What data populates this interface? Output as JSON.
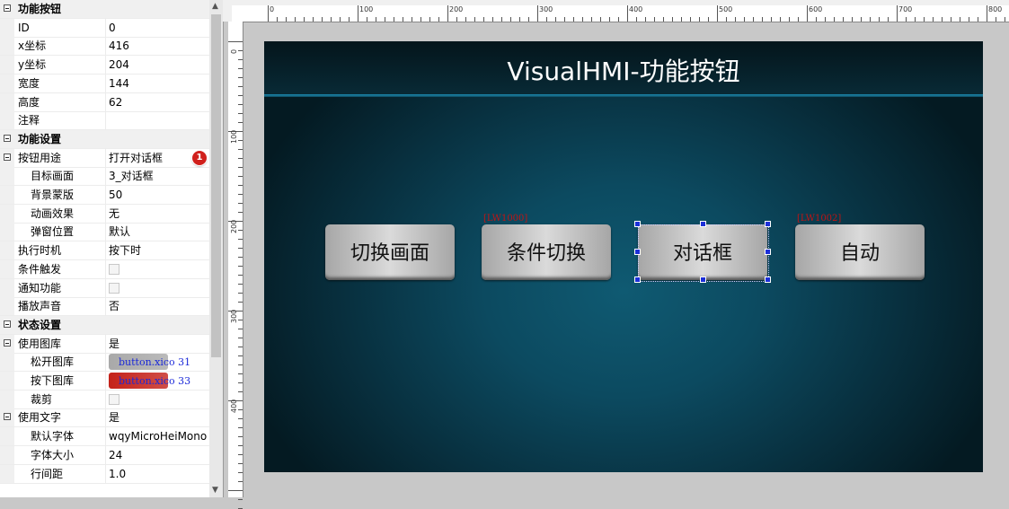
{
  "properties": [
    {
      "type": "category",
      "name": "功能按钮",
      "collapse_icon": "minus-box"
    },
    {
      "type": "prop",
      "name": "ID",
      "value": "0"
    },
    {
      "type": "prop",
      "name": "x坐标",
      "value": "416"
    },
    {
      "type": "prop",
      "name": "y坐标",
      "value": "204"
    },
    {
      "type": "prop",
      "name": "宽度",
      "value": "144"
    },
    {
      "type": "prop",
      "name": "高度",
      "value": "62"
    },
    {
      "type": "prop",
      "name": "注释",
      "value": ""
    },
    {
      "type": "category",
      "name": "功能设置",
      "collapse_icon": "minus-box"
    },
    {
      "type": "group",
      "name": "按钮用途",
      "value": "打开对话框",
      "badge": "1",
      "collapse_icon": "minus-box"
    },
    {
      "type": "sub",
      "name": "目标画面",
      "value": "3_对话框"
    },
    {
      "type": "sub",
      "name": "背景蒙版",
      "value": "50"
    },
    {
      "type": "sub",
      "name": "动画效果",
      "value": "无"
    },
    {
      "type": "sub",
      "name": "弹窗位置",
      "value": "默认"
    },
    {
      "type": "prop",
      "name": "执行时机",
      "value": "按下时"
    },
    {
      "type": "check",
      "name": "条件触发",
      "checked": false
    },
    {
      "type": "check",
      "name": "通知功能",
      "checked": false
    },
    {
      "type": "prop",
      "name": "播放声音",
      "value": "否"
    },
    {
      "type": "category",
      "name": "状态设置",
      "collapse_icon": "minus-box"
    },
    {
      "type": "group",
      "name": "使用图库",
      "value": "是",
      "collapse_icon": "minus-box"
    },
    {
      "type": "image",
      "name": "松开图库",
      "value": "button.xico 31",
      "color": "#a9a9a9"
    },
    {
      "type": "image",
      "name": "按下图库",
      "value": "button.xico 33",
      "color": "#c4221a"
    },
    {
      "type": "subcheck",
      "name": "裁剪",
      "checked": false
    },
    {
      "type": "group",
      "name": "使用文字",
      "value": "是",
      "collapse_icon": "minus-box"
    },
    {
      "type": "sub",
      "name": "默认字体",
      "value": "wqyMicroHeiMono"
    },
    {
      "type": "sub",
      "name": "字体大小",
      "value": "24"
    },
    {
      "type": "sub",
      "name": "行间距",
      "value": "1.0"
    }
  ],
  "ruler": {
    "h_labels": [
      "0",
      "100",
      "200",
      "300",
      "400",
      "500",
      "600",
      "700",
      "800"
    ],
    "v_labels": [
      "0",
      "100",
      "200",
      "300",
      "400"
    ]
  },
  "screen": {
    "title": "VisualHMI-功能按钮",
    "buttons": [
      {
        "label": "切换画面",
        "tag": ""
      },
      {
        "label": "条件切换",
        "tag": "[LW1000]"
      },
      {
        "label": "对话框",
        "tag": "",
        "selected": true
      },
      {
        "label": "自动",
        "tag": "[LW1002]"
      }
    ]
  },
  "colors": {
    "accent": "#1d8bb2",
    "badge": "#d0201c",
    "handle": "#1c2fd8",
    "tag": "#c01414"
  }
}
